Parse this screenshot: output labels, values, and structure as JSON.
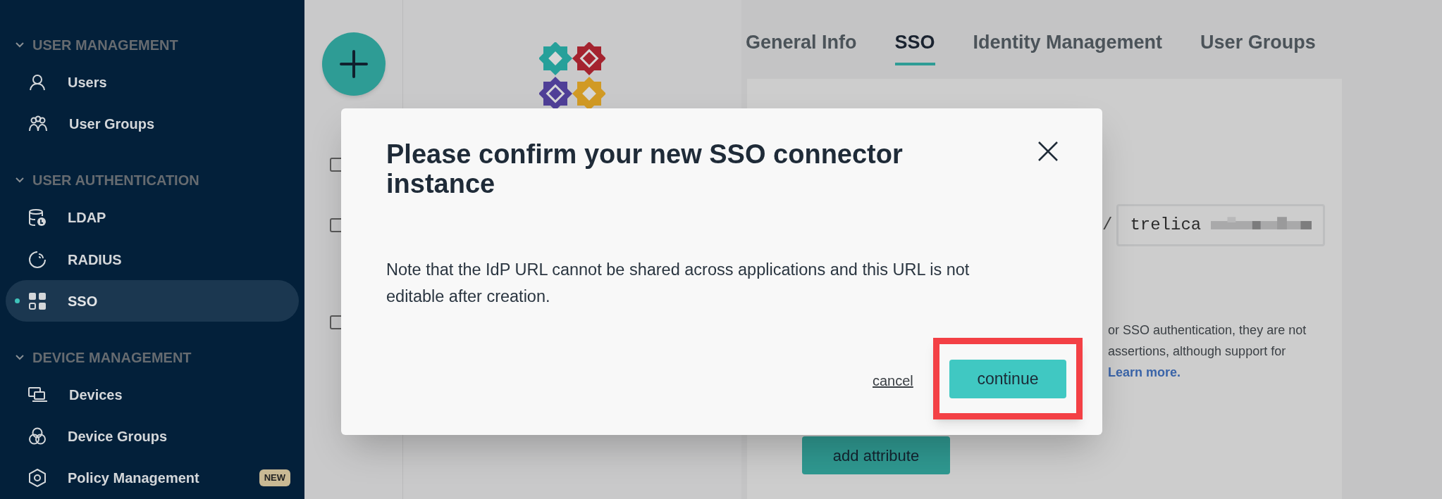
{
  "sidebar": {
    "sections": [
      {
        "title": "USER MANAGEMENT",
        "expanded": true,
        "items": [
          {
            "label": "Users",
            "selected": false
          },
          {
            "label": "User Groups",
            "selected": false
          }
        ]
      },
      {
        "title": "USER AUTHENTICATION",
        "expanded": true,
        "items": [
          {
            "label": "LDAP",
            "selected": false
          },
          {
            "label": "RADIUS",
            "selected": false
          },
          {
            "label": "SSO",
            "selected": true
          }
        ]
      },
      {
        "title": "DEVICE MANAGEMENT",
        "expanded": true,
        "items": [
          {
            "label": "Devices",
            "selected": false
          },
          {
            "label": "Device Groups",
            "selected": false
          },
          {
            "label": "Policy Management",
            "selected": false,
            "badge": "NEW"
          }
        ]
      }
    ]
  },
  "list_checkboxes": [
    {
      "checked": false
    },
    {
      "checked": false
    },
    {
      "checked": false
    }
  ],
  "tabs": [
    {
      "label": "General Info",
      "selected": false
    },
    {
      "label": "SSO",
      "selected": true
    },
    {
      "label": "Identity Management",
      "selected": false
    },
    {
      "label": "User Groups",
      "selected": false
    }
  ],
  "sso_form": {
    "url_prefix": "/",
    "url_value": "trelica",
    "note_lines": [
      "or SSO authentication, they are not",
      "assertions, although support for"
    ],
    "learn_more_link": "Learn more.",
    "add_attribute_button": "add attribute"
  },
  "modal": {
    "title": "Please confirm your new SSO connector instance",
    "body": "Note that the IdP URL cannot be shared across applications and this URL is not editable after creation.",
    "cancel": "cancel",
    "continue": "continue",
    "continue_highlighted": true
  }
}
